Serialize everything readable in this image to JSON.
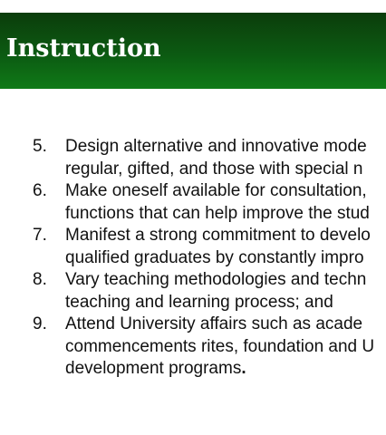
{
  "slide": {
    "title": "Instruction"
  },
  "list": {
    "items": [
      {
        "number": "5.",
        "lines": [
          "Design alternative and innovative mode",
          "regular, gifted, and those with special n"
        ]
      },
      {
        "number": "6.",
        "lines": [
          "Make oneself available for consultation,",
          "functions that can help improve the stud"
        ]
      },
      {
        "number": "7.",
        "lines": [
          "Manifest a strong commitment to develo",
          "qualified graduates by constantly impro"
        ]
      },
      {
        "number": "8.",
        "lines": [
          "Vary teaching methodologies and techn",
          "teaching and learning process; and"
        ]
      },
      {
        "number": "9.",
        "lines": [
          "Attend University affairs such as acade",
          "commencements rites, foundation and U",
          "development programs"
        ],
        "end_mark": "."
      }
    ]
  },
  "colors": {
    "banner_dark": "#0b3d0b",
    "banner_light": "#0f7a17",
    "text": "#111111",
    "title_text": "#ffffff"
  }
}
